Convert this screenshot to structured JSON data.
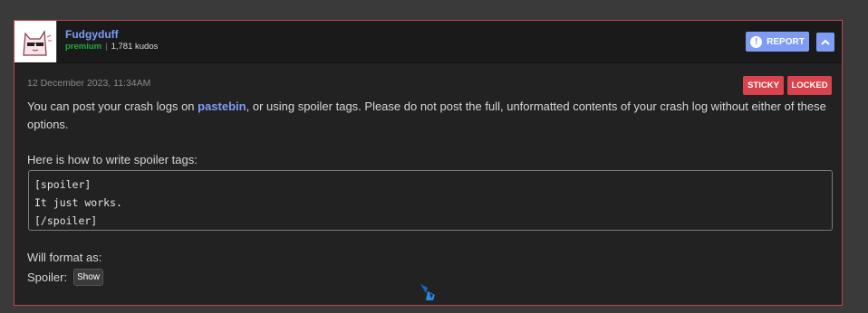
{
  "post": {
    "author": {
      "username": "Fudgyduff",
      "rank": "premium",
      "separator": "|",
      "kudos": "1,781 kudos"
    },
    "actions": {
      "report_label": "REPORT",
      "report_icon": "exclamation-icon",
      "collapse_icon": "chevron-up-icon"
    },
    "timestamp": "12 December 2023, 11:34AM",
    "badges": {
      "sticky": "STICKY",
      "locked": "LOCKED"
    },
    "body": {
      "intro_before_link": "You can post your crash logs on ",
      "link_text": "pastebin",
      "intro_after_link": ", or using spoiler tags. Please do not post the full, unformatted contents of your crash log without either of these options.",
      "howto": "Here is how to write spoiler tags:",
      "code_lines": [
        "[spoiler]",
        "It just works.",
        "[/spoiler]"
      ],
      "will_format": "Will format as:",
      "spoiler_label": "Spoiler:",
      "show_label": "Show"
    }
  },
  "colors": {
    "accent": "#7f9cf5",
    "badge": "#d9434d",
    "premium": "#1fae3c",
    "border": "#c0474f"
  }
}
